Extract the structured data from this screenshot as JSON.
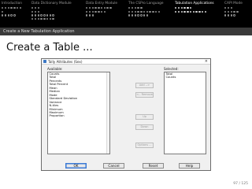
{
  "nav": {
    "sections": [
      {
        "label": "Introduction",
        "active": false,
        "rows": [
          7,
          1,
          5
        ]
      },
      {
        "label": "Data Dictionary Module",
        "active": false,
        "rows": [
          3,
          3,
          8,
          8
        ]
      },
      {
        "label": "Data Entry Module",
        "active": false,
        "rows": [
          9,
          7,
          3
        ]
      },
      {
        "label": "The CSPro Language",
        "active": false,
        "rows": [
          5,
          11,
          7
        ]
      },
      {
        "label": "Tabulation Applications",
        "active": true,
        "rows": [
          6,
          11
        ],
        "current_dot": 4
      },
      {
        "label": "CAPI Mode",
        "active": false,
        "rows": [
          3,
          5,
          4
        ]
      }
    ],
    "subsection": "Create a New Tabulation Application"
  },
  "frame_title": "Create a Table ...",
  "dialog": {
    "title": "Tally Attributes (Sex)",
    "close_icon": "close-icon",
    "available_label": "Available:",
    "selected_label": "Selected:",
    "available_items": [
      "Counts",
      "Total",
      "Percents",
      "Total Percent",
      "Mean",
      "Median",
      "Mode",
      "Standard Deviation",
      "Variance",
      "N-tiles",
      "Minimum",
      "Maximum",
      "Proportion"
    ],
    "selected_items": [
      "Total",
      "Counts"
    ],
    "middle_buttons": [
      {
        "name": "add-button",
        "label": "Add -->"
      },
      {
        "name": "remove-button",
        "label": "<-- Remove"
      },
      {
        "name": "up-button",
        "label": "Up"
      },
      {
        "name": "down-button",
        "label": "Down"
      },
      {
        "name": "options-button",
        "label": "Options ..."
      }
    ],
    "bottom_buttons": [
      {
        "name": "ok-button",
        "label": "OK"
      },
      {
        "name": "cancel-button",
        "label": "Cancel"
      },
      {
        "name": "reset-button",
        "label": "Reset"
      },
      {
        "name": "help-button",
        "label": "Help"
      }
    ]
  },
  "page_number": "97 / 125",
  "colors": {
    "nav_bg": "#000000",
    "subbar_bg": "#3a3a3a",
    "dialog_bg": "#f0f0f0",
    "default_button_border": "#3b7ad6"
  }
}
